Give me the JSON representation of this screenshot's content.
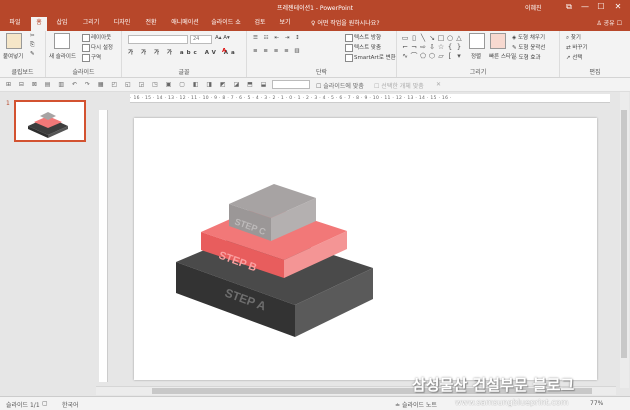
{
  "window": {
    "title": "프레젠테이션1  -  PowerPoint",
    "user": "이혜진",
    "controls": [
      "⧉",
      "—",
      "☐",
      "✕"
    ]
  },
  "tabs": [
    "파일",
    "홈",
    "삽입",
    "그리기",
    "디자인",
    "전환",
    "애니메이션",
    "슬라이드 쇼",
    "검토",
    "보기"
  ],
  "active_tab": "홈",
  "tell_me": "어떤 작업을 원하시나요?",
  "share": "공유",
  "ribbon": {
    "clipboard": {
      "label": "클립보드",
      "paste": "붙여넣기"
    },
    "slides": {
      "label": "슬라이드",
      "new_slide": "새 슬라이드",
      "layout": "레이아웃",
      "reset": "다시 설정",
      "section": "구역"
    },
    "font": {
      "label": "글꼴",
      "font_name": "",
      "font_size": "24"
    },
    "paragraph": {
      "label": "단락",
      "text_dir": "텍스트 방향",
      "align_text": "텍스트 맞춤",
      "smartart": "SmartArt로 변환"
    },
    "drawing": {
      "label": "그리기",
      "arrange": "정렬",
      "quick_styles": "빠른 스타일",
      "fill": "도형 채우기",
      "outline": "도형 윤곽선",
      "effects": "도형 효과"
    },
    "editing": {
      "label": "편집",
      "find": "찾기",
      "replace": "바꾸기",
      "select": "선택"
    }
  },
  "subbar": {
    "snap_label": "슬라이드에 맞춤",
    "select_label": "선택한 개체 맞춤"
  },
  "ruler_h": "· 16 · 15 · 14 · 13 · 12 · 11 · 10 · 9 · 8 · 7 · 6 · 5 · 4 · 3 · 2 · 1 · 0 · 1 · 2 · 3 · 4 · 5 · 6 · 7 · 8 · 9 · 10 · 11 · 12 · 13 · 14 · 15 · 16 ·",
  "slide_number": "1",
  "steps": {
    "a": "STEP A",
    "b": "STEP B",
    "c": "STEP C"
  },
  "status": {
    "slide": "슬라이드 1/1",
    "lang": "한국어",
    "notes": "슬라이드 노트",
    "zoom": "77%"
  },
  "colors": {
    "accent": "#b7472a",
    "step_a": "#4a4a4a",
    "step_b": "#f27878",
    "step_c": "#a7a3a3"
  },
  "watermark": "삼성물산 건설부문 블로그",
  "watermark_url": "www.samsungblueprint.com"
}
